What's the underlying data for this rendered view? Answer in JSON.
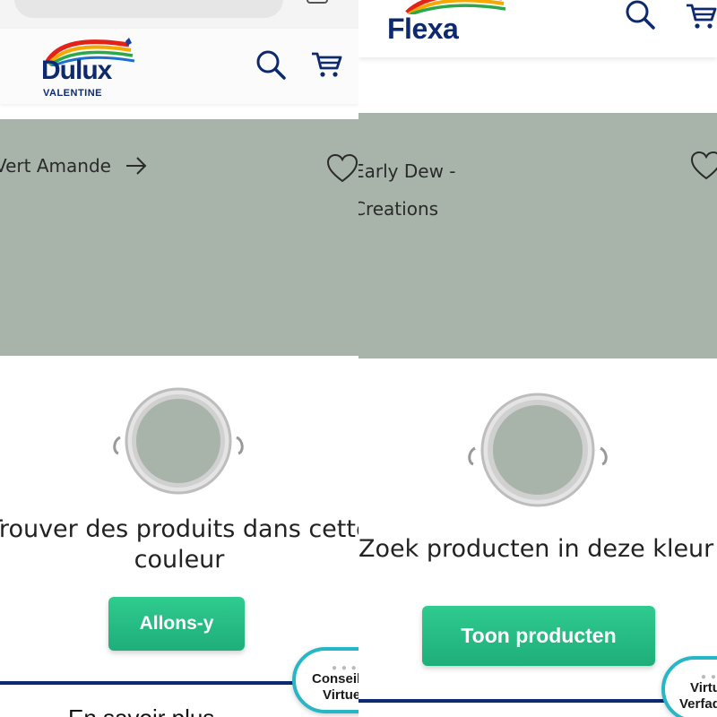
{
  "left": {
    "brand": {
      "name": "Dulux",
      "sub": "VALENTINE"
    },
    "color_name": "Vert Amande",
    "headline": "Trouver des produits dans cette couleur",
    "cta_label": "Allons-y",
    "chat_line1": "Conseil",
    "chat_line2": "Virtuel",
    "footer_peek": "En savoir plus"
  },
  "right": {
    "brand": {
      "name": "Flexa"
    },
    "color_name_line1": "Early Dew -",
    "color_name_line2": "Creations",
    "headline": "Zoek producten in deze kleur",
    "cta_label": "Toon producten",
    "chat_line1": "Virtueel",
    "chat_line2": "Verfadvies"
  },
  "icons": [
    "search-icon",
    "cart-icon",
    "arrow-right-icon",
    "heart-icon",
    "paint-can-icon",
    "tab-switcher-icon"
  ],
  "colors": {
    "swatch": "#a8b4a9",
    "brand_navy": "#0d2a6e",
    "cta_green": "#25bb83",
    "chat_teal": "#26b6c6"
  }
}
